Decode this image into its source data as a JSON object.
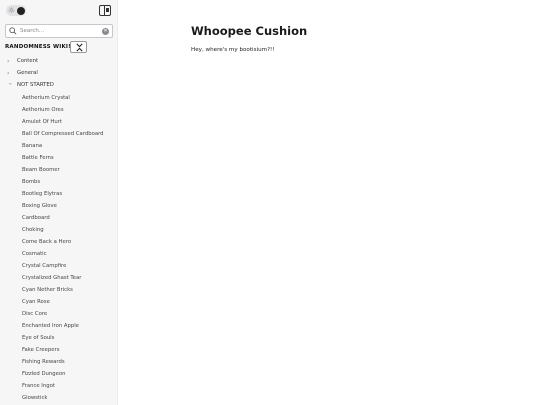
{
  "topbar": {
    "theme_toggle": {
      "light_icon": "sun-icon",
      "dark_icon": "moon-icon"
    },
    "layout_icon": "sidebar-layout-icon"
  },
  "search": {
    "placeholder": "Search...",
    "value": ""
  },
  "sidebar": {
    "wiki_title": "RANDOMNESS WIKI!",
    "collapse_icon": "collapse-all-icon",
    "folders": [
      {
        "label": "Content",
        "expanded": false
      },
      {
        "label": "General",
        "expanded": false
      },
      {
        "label": "NOT STARTED",
        "expanded": true
      }
    ],
    "pages": [
      "Aetherium Crystal",
      "Aetherium Ores",
      "Amulet Of Hurt",
      "Ball Of Compressed Cardboard",
      "Banana",
      "Battle Ferns",
      "Beam Boomer",
      "Bombs",
      "Bootleg Elytras",
      "Boxing Glove",
      "Cardboard",
      "Choking",
      "Come Back a Hero",
      "Cosmatic",
      "Crystal Campfire",
      "Crystalized Ghast Tear",
      "Cyan Nether Bricks",
      "Cyan Rose",
      "Disc Core",
      "Enchanted Iron Apple",
      "Eye of Souls",
      "Fake Creepers",
      "Fishing Rewards",
      "Fizzled Dungeon",
      "France Ingot",
      "Glowstick"
    ]
  },
  "main": {
    "title": "Whoopee Cushion",
    "body": "Hey, where's my bootisium?!!"
  }
}
